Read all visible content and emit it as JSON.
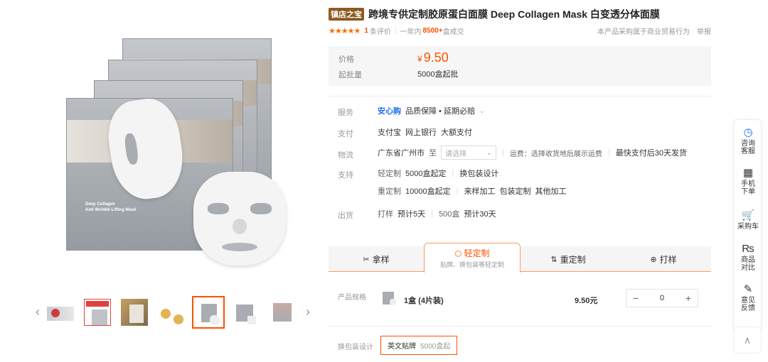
{
  "product": {
    "badge": "镇店之宝",
    "title": "跨境专供定制胶原蛋白面膜 Deep Collagen Mask 白变透分体面膜"
  },
  "rating": {
    "stars": "★★★★★",
    "review_count": "1",
    "review_text": "条评价",
    "period_text": "一年内",
    "sales_count": "8500+",
    "sales_text": "盒成交",
    "notice": "本产品采购属于商业贸易行为",
    "report": "举报"
  },
  "price": {
    "price_label": "价格",
    "currency": "¥",
    "value": "9.50",
    "moq_label": "起批量",
    "moq": "5000盒起批"
  },
  "service": {
    "label": "服务",
    "brand": "安心购",
    "text": "品质保障 • 延期必赔"
  },
  "payment": {
    "label": "支付",
    "methods": [
      "支付宝",
      "网上银行",
      "大额支付"
    ]
  },
  "logistics": {
    "label": "物流",
    "origin": "广东省广州市",
    "to": "至",
    "placeholder": "请选择",
    "freight": "运费：选择收货地后展示运费",
    "ship_time": "最快支付后30天发货"
  },
  "support": {
    "label": "支持",
    "line1": {
      "type": "轻定制",
      "moq": "5000盒起定",
      "extra": "换包装设计"
    },
    "line2": {
      "type": "重定制",
      "moq": "10000盒起定",
      "items": [
        "来样加工",
        "包装定制",
        "其他加工"
      ]
    }
  },
  "shipping": {
    "label": "出货",
    "sample_type": "打样",
    "sample_time": "预计5天",
    "bulk_qty": "500盒",
    "bulk_time": "预计30天"
  },
  "tabs": [
    {
      "icon": "✂",
      "label": "拿样"
    },
    {
      "icon": "⬡",
      "label": "轻定制",
      "sub": "贴牌、换包装等轻定制"
    },
    {
      "icon": "⇅",
      "label": "重定制"
    },
    {
      "icon": "⊕",
      "label": "打样"
    }
  ],
  "spec": {
    "label": "产品规格",
    "name": "1盒 (4片装)",
    "price": "9.50元",
    "qty": "0",
    "minus": "−",
    "plus": "+"
  },
  "pack_design": {
    "label": "换包装设计",
    "option": "英文贴牌",
    "option_moq": "5000盒起"
  },
  "sidebar": [
    {
      "icon": "◷",
      "label": "咨询\n客服"
    },
    {
      "icon": "▦",
      "label": "手机\n下单"
    },
    {
      "icon": "🛒",
      "label": "采购车"
    },
    {
      "icon": "₨",
      "label": "商品\n对比"
    },
    {
      "icon": "✎",
      "label": "意见\n反馈"
    }
  ],
  "image_text": {
    "line1": "Deep Collagen",
    "line2": "Anti Wrinkle Lifting Mask"
  },
  "back_top_icon": "∧"
}
